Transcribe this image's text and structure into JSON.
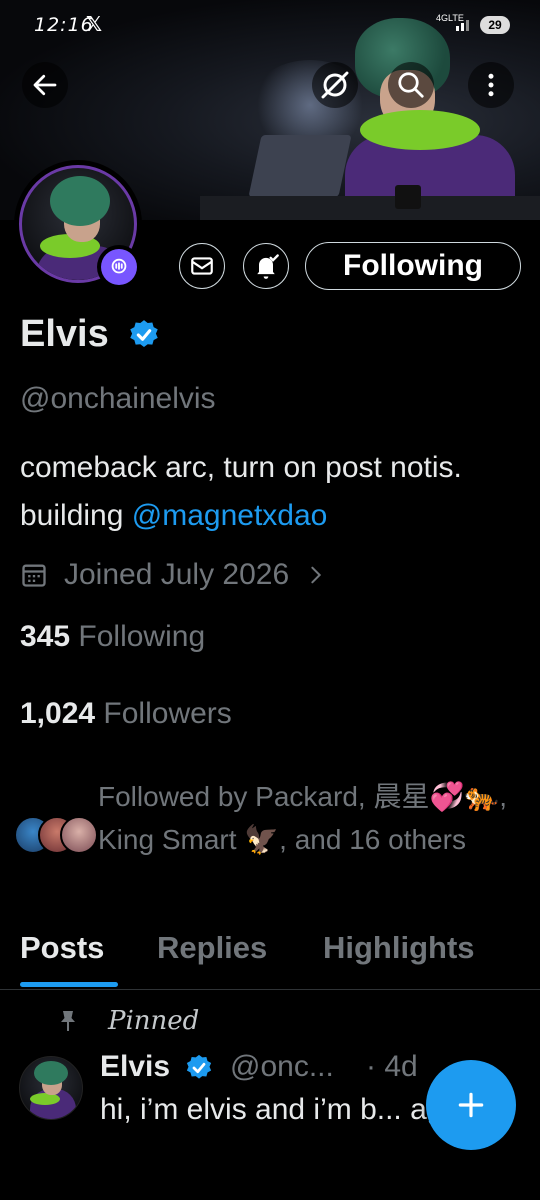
{
  "status_bar": {
    "time": "12:16",
    "app_glyph": "𝕏",
    "network": "4GLTE",
    "battery": "29"
  },
  "header": {
    "back_icon": "arrow-left-icon",
    "grok_icon": "grok-icon",
    "search_icon": "search-icon",
    "more_icon": "more-vertical-icon"
  },
  "profile": {
    "name": "Elvis",
    "handle": "@onchainelvis",
    "bio_text": "comeback arc, turn on post notis. building ",
    "bio_mention": "@magnetxdao",
    "joined": "Joined July 2026",
    "following_count": "345",
    "following_label": "Following",
    "followers_count": "1,024",
    "followers_label": "Followers",
    "followed_by": "Followed by Packard, 晨星💞🐅, King Smart 🦅, and 16 others"
  },
  "actions": {
    "following_button": "Following",
    "message_icon": "mail-icon",
    "notify_icon": "bell-check-icon"
  },
  "tabs": [
    {
      "label": "Posts",
      "active": true
    },
    {
      "label": "Replies"
    },
    {
      "label": "Highlights"
    }
  ],
  "pinned_post": {
    "pinned_label": "Pinned",
    "author": "Elvis",
    "handle": "@onc...",
    "time": "· 4d",
    "text": "hi, i’m elvis and i’m b... again."
  },
  "colors": {
    "accent": "#1d9bf0",
    "verified": "#1d9bf0",
    "muted": "#71767b",
    "background": "#000000"
  }
}
